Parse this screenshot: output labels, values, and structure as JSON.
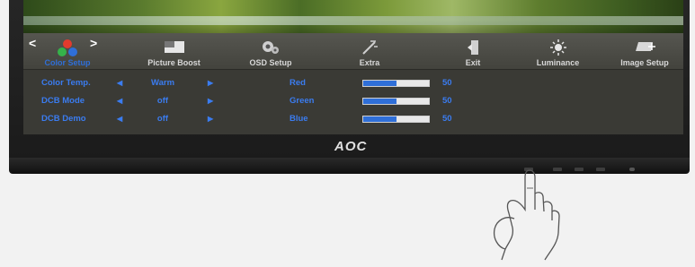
{
  "brand": "AOC",
  "tabs": [
    {
      "label": "Color Setup",
      "icon": "color-setup-icon",
      "active": true
    },
    {
      "label": "Picture Boost",
      "icon": "picture-boost-icon",
      "active": false
    },
    {
      "label": "OSD Setup",
      "icon": "osd-setup-icon",
      "active": false
    },
    {
      "label": "Extra",
      "icon": "extra-icon",
      "active": false
    },
    {
      "label": "Exit",
      "icon": "exit-icon",
      "active": false
    },
    {
      "label": "Luminance",
      "icon": "luminance-icon",
      "active": false
    },
    {
      "label": "Image Setup",
      "icon": "image-setup-icon",
      "active": false
    }
  ],
  "settings": [
    {
      "label": "Color Temp.",
      "value": "Warm"
    },
    {
      "label": "DCB Mode",
      "value": "off"
    },
    {
      "label": "DCB Demo",
      "value": "off"
    }
  ],
  "channels": [
    {
      "label": "Red",
      "value": "50",
      "fraction": 0.5
    },
    {
      "label": "Green",
      "value": "50",
      "fraction": 0.5
    },
    {
      "label": "Blue",
      "value": "50",
      "fraction": 0.5
    }
  ],
  "colors": {
    "accent": "#2f6fd8",
    "label": "#3a7cf0"
  }
}
